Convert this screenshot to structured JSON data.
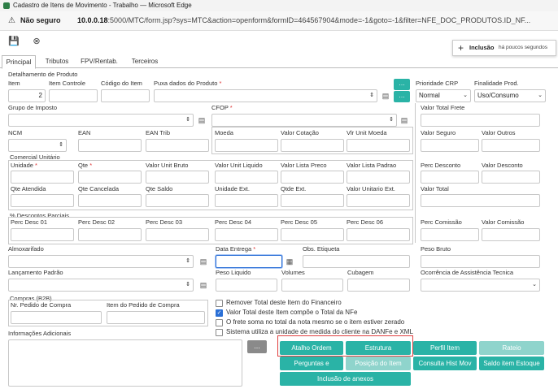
{
  "window": {
    "title": "Cadastro de Itens de Movimento - Trabalho — Microsoft Edge"
  },
  "browser": {
    "security": "Não seguro",
    "url_host": "10.0.0.18",
    "url_rest": ":5000/MTC/form.jsp?sys=MTC&action=openform&formID=464567904&mode=-1&goto=-1&filter=NFE_DOC_PRODUTOS.ID_NF..."
  },
  "toast": {
    "title": "Inclusão",
    "time": "há poucos segundos"
  },
  "tabs": [
    "Principal",
    "Tributos",
    "FPV/Rentab.",
    "Terceiros"
  ],
  "sections": {
    "detalhamento": "Detalhamento de Produto",
    "comercial": "Comercial Unitário",
    "descontos": "% Descontos Parciais",
    "compras": "Compras (B2B)"
  },
  "fields": {
    "item": {
      "label": "Item",
      "value": "2"
    },
    "item_controle": "Item Controle",
    "codigo_item": "Código do Item",
    "puxa_dados": "Puxa dados do Produto",
    "prioridade_crp": {
      "label": "Prioridade CRP",
      "value": "Normal"
    },
    "finalidade": {
      "label": "Finalidade Prod.",
      "value": "Uso/Consumo"
    },
    "grupo_imposto": "Grupo de Imposto",
    "cfop": "CFOP",
    "valor_total_frete": "Valor Total Frete",
    "ncm": "NCM",
    "ean": "EAN",
    "ean_trib": "EAN Trib",
    "moeda": "Moeda",
    "valor_cotacao": "Valor Cotação",
    "vlr_unit_moeda": "Vlr Unit Moeda",
    "valor_seguro": "Valor Seguro",
    "valor_outros": "Valor Outros",
    "unidade": "Unidade",
    "qte": "Qte",
    "valor_unit_bruto": "Valor Unit Bruto",
    "valor_unit_liquido": "Valor Unit Liquido",
    "valor_lista_preco": "Valor Lista Preco",
    "valor_lista_padrao": "Valor Lista Padrao",
    "perc_desconto": "Perc Desconto",
    "valor_desconto": "Valor Desconto",
    "qte_atendida": "Qte Atendida",
    "qte_cancelada": "Qte Cancelada",
    "qte_saldo": "Qte Saldo",
    "unidade_ext": "Unidade Ext.",
    "qtde_ext": "Qtde Ext.",
    "valor_unitario_ext": "Valor Unitario Ext.",
    "valor_total": "Valor Total",
    "perc_desc_01": "Perc Desc 01",
    "perc_desc_02": "Perc Desc 02",
    "perc_desc_03": "Perc Desc 03",
    "perc_desc_04": "Perc Desc 04",
    "perc_desc_05": "Perc Desc 05",
    "perc_desc_06": "Perc Desc 06",
    "perc_comissao": "Perc Comissão",
    "valor_comissao": "Valor Comissão",
    "almoxarifado": "Almoxarifado",
    "data_entrega": "Data Entrega",
    "obs_etiqueta": "Obs. Etiqueta",
    "peso_bruto": "Peso Bruto",
    "lancamento_padrao": "Lançamento Padrão",
    "peso_liquido": "Peso Liquido",
    "volumes": "Volumes",
    "cubagem": "Cubagem",
    "ocorrencia": "Ocorrência de Assistência Tecnica",
    "nr_pedido": "Nr. Pedido de Compra",
    "item_pedido": "Item do Pedido de Compra",
    "informacoes": "Informações Adicionais"
  },
  "checkboxes": [
    {
      "label": "Remover Total deste Item do Financeiro",
      "checked": false
    },
    {
      "label": "Valor Total deste Item compõe o Total da NFe",
      "checked": true
    },
    {
      "label": "O frete soma no total da nota mesmo se o item estiver zerado",
      "checked": false
    },
    {
      "label": "Sistema utiliza a unidade de medida do cliente na DANFe e XML",
      "checked": false
    }
  ],
  "buttons": {
    "dots": "...",
    "atalho_ordem": "Atalho Ordem",
    "estrutura": "Estrutura",
    "perfil_item": "Perfil Item",
    "rateio": "Rateio",
    "perguntas": "Perguntas e",
    "posicao_item": "Posição do Item",
    "consulta_hist": "Consulta Hist Mov",
    "saldo_item": "Saldo item Estoque",
    "inclusao_anexos": "Inclusão de anexos"
  },
  "colors": {
    "accent": "#2ab3a6",
    "accent_light": "#8fd4cc",
    "required": "#dd3333",
    "highlight": "#e04040"
  }
}
